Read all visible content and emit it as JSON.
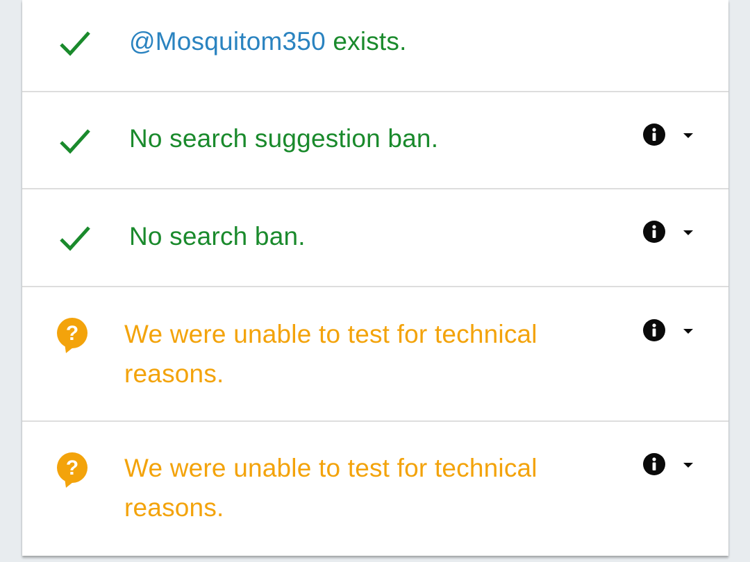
{
  "colors": {
    "ok_green": "#1a8a2c",
    "warn_orange": "#f3a30b",
    "handle_blue": "#2a83c0",
    "icon_black": "#0a0a0a"
  },
  "checks": [
    {
      "status": "ok",
      "icon": "checkmark-icon",
      "handle": "@Mosquitom350",
      "text": " exists.",
      "has_info": false
    },
    {
      "status": "ok",
      "icon": "checkmark-icon",
      "text": "No search suggestion ban.",
      "has_info": true
    },
    {
      "status": "ok",
      "icon": "checkmark-icon",
      "text": "No search ban.",
      "has_info": true
    },
    {
      "status": "unknown",
      "icon": "question-bubble-icon",
      "text": "We were unable to test for technical reasons.",
      "has_info": true
    },
    {
      "status": "unknown",
      "icon": "question-bubble-icon",
      "text": "We were unable to test for technical reasons.",
      "has_info": true
    }
  ]
}
